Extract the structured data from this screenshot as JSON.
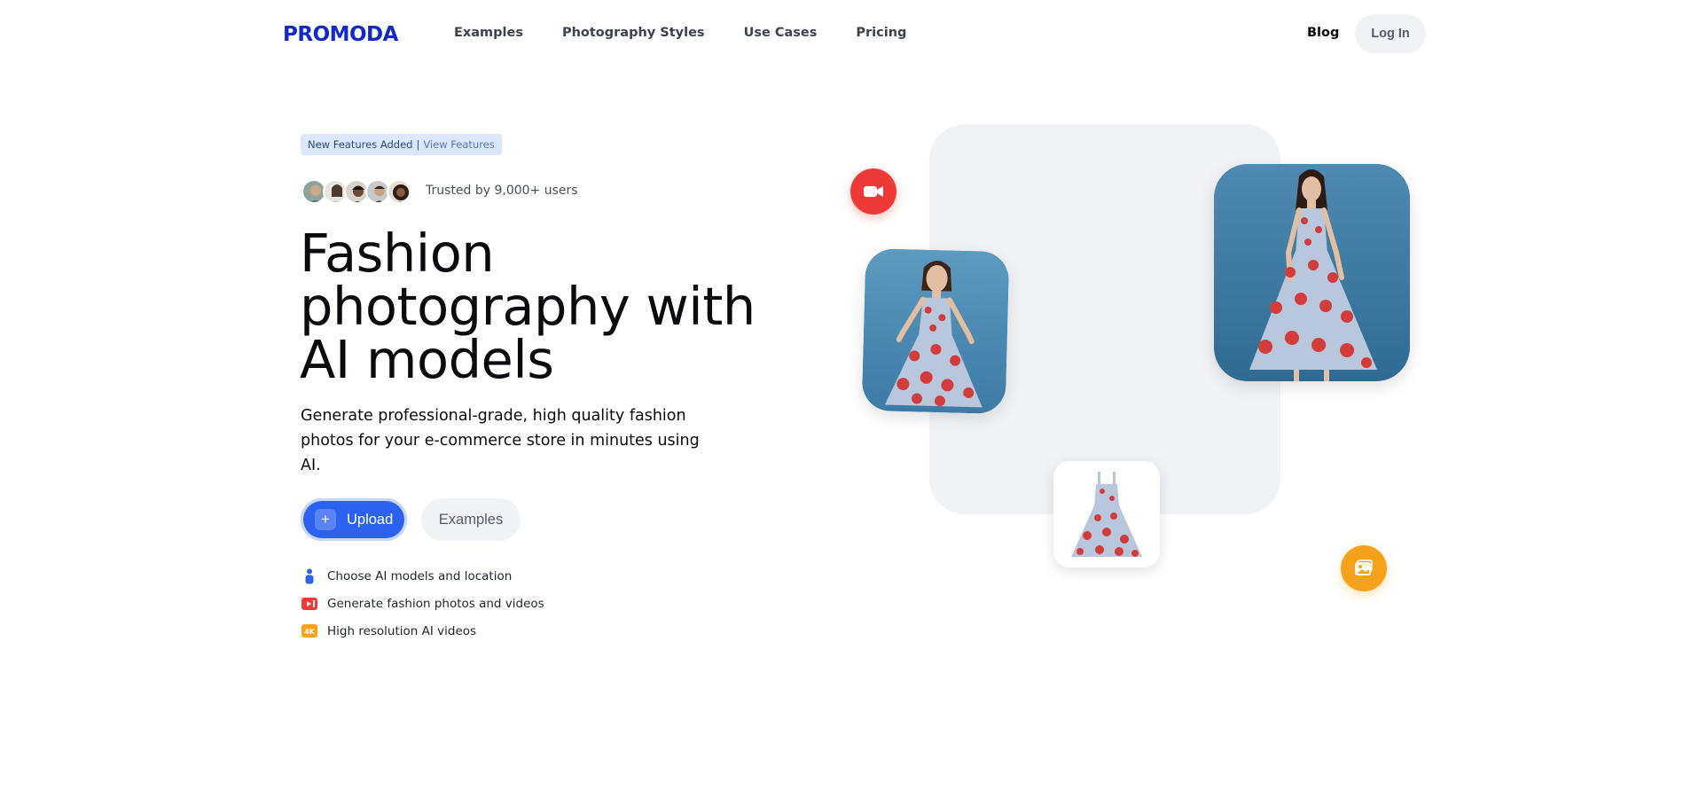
{
  "nav": {
    "logo": "PROMODA",
    "links": [
      "Examples",
      "Photography Styles",
      "Use Cases",
      "Pricing"
    ],
    "blog": "Blog",
    "login": "Log In"
  },
  "hero": {
    "badge_left": "New Features Added",
    "badge_sep": "|",
    "badge_right": "View Features",
    "trusted": "Trusted by 9,000+ users",
    "headline_1": "Fashion",
    "headline_2": "photography with",
    "headline_3": "AI models",
    "subhead": "Generate professional-grade, high quality fashion photos for your e-commerce store in minutes using AI.",
    "upload_label": "Upload",
    "examples_label": "Examples",
    "bullets": [
      {
        "icon": "person-icon",
        "text": "Choose AI models and location"
      },
      {
        "icon": "video-icon",
        "text": "Generate fashion photos and videos"
      },
      {
        "icon": "4k-icon",
        "text": "High resolution AI videos",
        "badge": "4K"
      }
    ]
  },
  "colors": {
    "brand": "#1228c9",
    "primary_button": "#2d62f0",
    "red_accent": "#f03a3a",
    "orange_accent": "#f7a21b",
    "photo_background": "#4f8ab2"
  }
}
